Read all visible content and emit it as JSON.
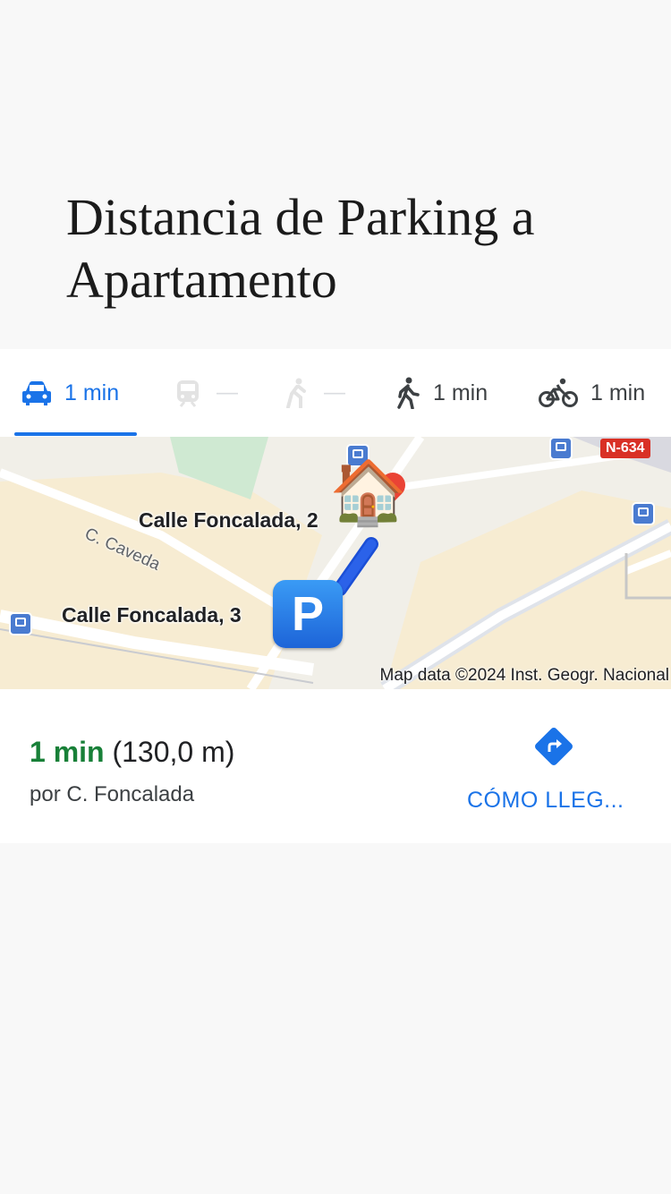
{
  "heading": "Distancia de Parking a Apartamento",
  "tabs": [
    {
      "mode": "driving",
      "icon": "car-icon",
      "label": "1 min",
      "active": true
    },
    {
      "mode": "transit",
      "icon": "train-icon",
      "label": "—",
      "active": false
    },
    {
      "mode": "ride",
      "icon": "ride-icon",
      "label": "—",
      "active": false
    },
    {
      "mode": "walking",
      "icon": "walking-icon",
      "label": "1 min",
      "active": false
    },
    {
      "mode": "cycling",
      "icon": "bicycle-icon",
      "label": "1 min",
      "active": false
    }
  ],
  "map": {
    "destination_label": "Calle Foncalada, 2",
    "origin_label": "Calle Foncalada, 3",
    "street_label": "C. Caveda",
    "road_badge": "N-634",
    "attribution": "Map data ©2024 Inst. Geogr. Nacional",
    "destination_emoji": "🏠",
    "parking_symbol": "P",
    "route_color": "#2b62e9",
    "pin_color": "#ea4335"
  },
  "summary": {
    "duration": "1 min",
    "distance": "(130,0 m)",
    "via": "por C. Foncalada",
    "directions_label": "CÓMO LLEG...",
    "duration_color": "#188038",
    "accent_color": "#1a73e8"
  }
}
